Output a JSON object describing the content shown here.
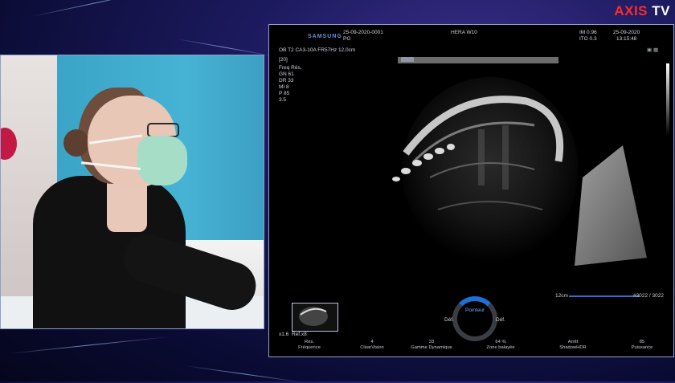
{
  "brand": {
    "logo_left": "AXIS",
    "logo_right": "TV"
  },
  "ultrasound": {
    "vendor": "SAMSUNG",
    "header_id": "25-09-2020-0001",
    "header_pg": "PG",
    "model": "HERA W10",
    "im": "IM 0.96",
    "ito": "ITO 0.3",
    "date": "25-09-2020",
    "time": "13:15:48",
    "preset_line": "OB  T2  CA3-10A  FR57Hz  12,0cm",
    "box_number": "[20]",
    "params": [
      "Freq   Rés.",
      "GN     61",
      "DR     33",
      "MI     8",
      "P      85",
      "3.5"
    ],
    "depth_label": "12cm",
    "depth_value": "#3022 / 3022",
    "thumb_left": "x1.6",
    "thumb_right": "Ref.x8",
    "pointer_label": "Pointeur",
    "dial_left": "Déf.",
    "dial_right": "Déf.",
    "bottom_controls": [
      {
        "value": "Rés.",
        "label": "Fréquence"
      },
      {
        "value": "4",
        "label": "ClearVision"
      },
      {
        "value": "33",
        "label": "Gamme Dynamique"
      },
      {
        "value": "64 %",
        "label": "Zone balayée"
      },
      {
        "value": "Arrêt",
        "label": "ShadowHDR"
      },
      {
        "value": "85",
        "label": "Puissance"
      }
    ]
  }
}
